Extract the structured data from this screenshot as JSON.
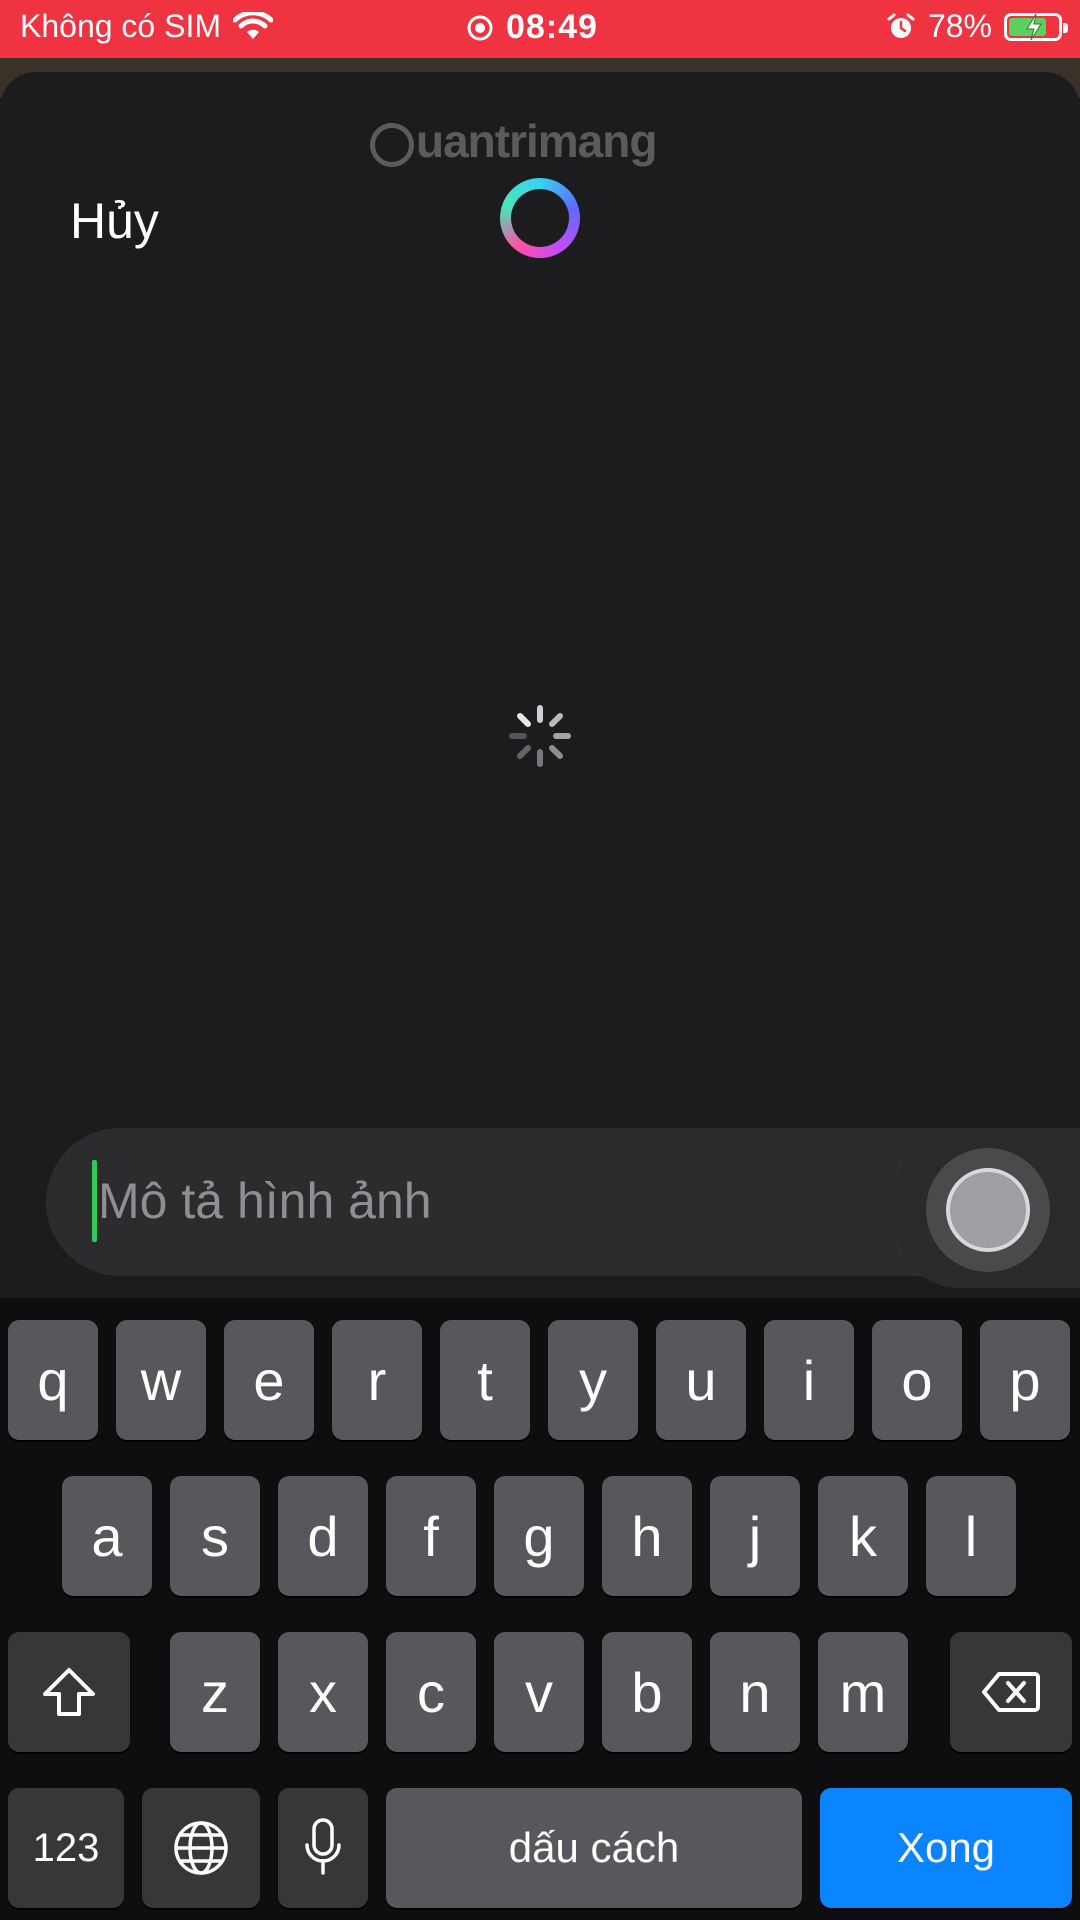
{
  "status_bar": {
    "carrier": "Không có SIM",
    "time": "08:49",
    "battery_percent": "78%",
    "battery_level": 0.78,
    "icons": [
      "wifi-icon",
      "screen-record-icon",
      "alarm-icon",
      "battery-charging-icon"
    ],
    "background_color": "#ef3340"
  },
  "watermark": {
    "text": "uantrimang"
  },
  "header": {
    "cancel_label": "Hủy"
  },
  "prompt": {
    "placeholder": "Mô tả hình ảnh"
  },
  "keyboard": {
    "row1": [
      "q",
      "w",
      "e",
      "r",
      "t",
      "y",
      "u",
      "i",
      "o",
      "p"
    ],
    "row2": [
      "a",
      "s",
      "d",
      "f",
      "g",
      "h",
      "j",
      "k",
      "l"
    ],
    "row3": [
      "z",
      "x",
      "c",
      "v",
      "b",
      "n",
      "m"
    ],
    "numbers_label": "123",
    "space_label": "dấu cách",
    "done_label": "Xong",
    "accent_color": "#0a84ff"
  }
}
